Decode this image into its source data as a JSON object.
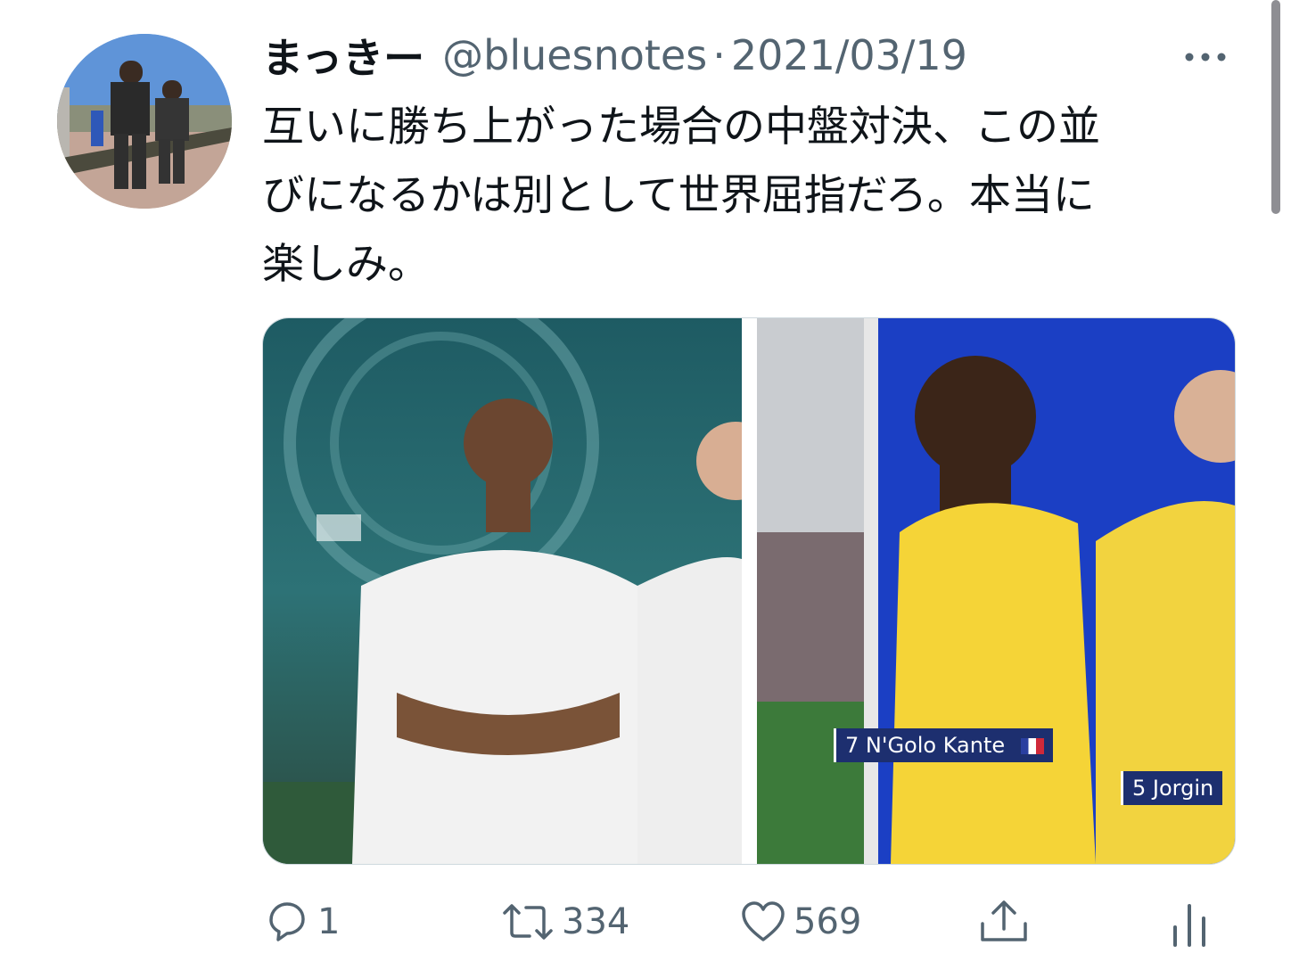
{
  "tweet": {
    "display_name": "まっきー",
    "handle": "@bluesnotes",
    "separator": "·",
    "date": "2021/03/19",
    "more_icon": "more-horizontal-icon",
    "text_lines": [
      "互いに勝ち上がった場合の中盤対決、この並",
      "びになるかは別として世界屈指だろ。本当に",
      "楽しみ。"
    ]
  },
  "media": {
    "left_image": "real-madrid-players-photo",
    "right_image": "chelsea-players-photo",
    "captions": {
      "kante": "7 N'Golo Kante",
      "jorginho": "5 Jorgin"
    },
    "brand_color": "#1d2f6f"
  },
  "actions": {
    "reply_count": "1",
    "retweet_count": "334",
    "like_count": "569"
  }
}
